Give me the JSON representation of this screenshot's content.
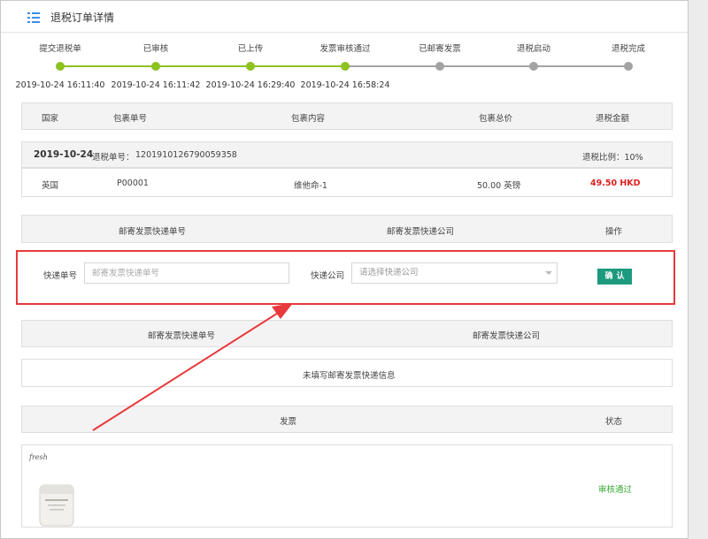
{
  "header": {
    "title": "退税订单详情",
    "icon": "list-icon"
  },
  "steps": [
    {
      "label": "提交退税单",
      "time": "2019-10-24 16:11:40",
      "done": true
    },
    {
      "label": "已审核",
      "time": "2019-10-24 16:11:42",
      "done": true
    },
    {
      "label": "已上传",
      "time": "2019-10-24 16:29:40",
      "done": true
    },
    {
      "label": "发票审核通过",
      "time": "2019-10-24 16:58:24",
      "done": true
    },
    {
      "label": "已邮寄发票",
      "time": "",
      "done": false
    },
    {
      "label": "退税启动",
      "time": "",
      "done": false
    },
    {
      "label": "退税完成",
      "time": "",
      "done": false
    }
  ],
  "colors": {
    "done": "#8dc21f",
    "pending": "#a3a3a3",
    "accent": "#1d9a7d",
    "highlight": "#e8393c",
    "amount": "#e02020",
    "status": "#3aa836"
  },
  "order_table": {
    "headers": {
      "country": "国家",
      "package_no": "包裹单号",
      "content": "包裹内容",
      "total": "包裹总价",
      "refund": "退税金额"
    },
    "group": {
      "date": "2019-10-24",
      "refund_no_label": "退税单号：",
      "refund_no": "1201910126790059358",
      "ratio": "退税比例：10%"
    },
    "row": {
      "country": "英国",
      "package_no": "P00001",
      "content": "维他命-1",
      "total": "50.00 英镑",
      "refund": "49.50 HKD"
    }
  },
  "mail_form": {
    "headers": {
      "tracking": "邮寄发票快递单号",
      "company": "邮寄发票快递公司",
      "action": "操作"
    },
    "tracking_label": "快递单号",
    "tracking_placeholder": "邮寄发票快递单号",
    "company_label": "快递公司",
    "company_placeholder": "请选择快递公司",
    "confirm": "确认"
  },
  "mail_info": {
    "headers": {
      "tracking": "邮寄发票快递单号",
      "company": "邮寄发票快递公司"
    },
    "empty": "未填写邮寄发票快递信息"
  },
  "invoice_table": {
    "headers": {
      "invoice": "发票",
      "status": "状态"
    },
    "brand": "fresh",
    "status": "审核通过"
  }
}
